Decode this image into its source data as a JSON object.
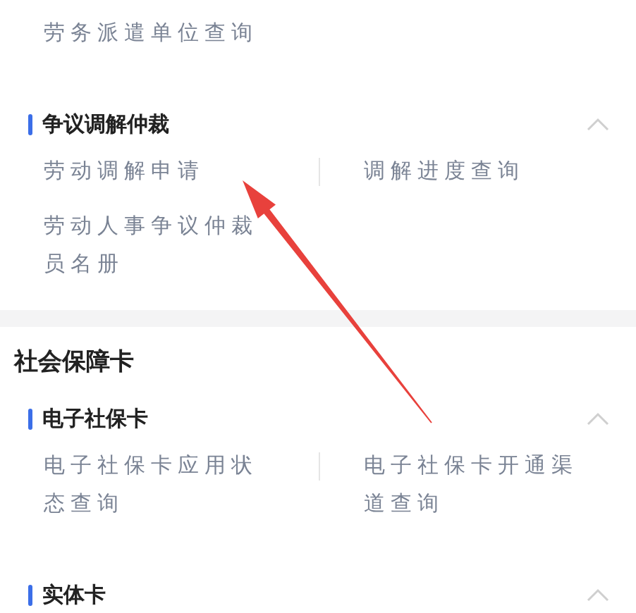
{
  "cards": [
    {
      "groups": [
        {
          "items": [
            "劳务派遣单位查询"
          ]
        },
        {
          "title": "争议调解仲裁",
          "expanded": true,
          "items": [
            "劳动调解申请",
            "调解进度查询",
            "劳动人事争议仲裁员名册"
          ]
        }
      ]
    },
    {
      "title": "社会保障卡",
      "groups": [
        {
          "title": "电子社保卡",
          "expanded": true,
          "items": [
            "电子社保卡应用状态查询",
            "电子社保卡开通渠道查询"
          ]
        },
        {
          "title": "实体卡",
          "expanded": true
        }
      ]
    }
  ]
}
